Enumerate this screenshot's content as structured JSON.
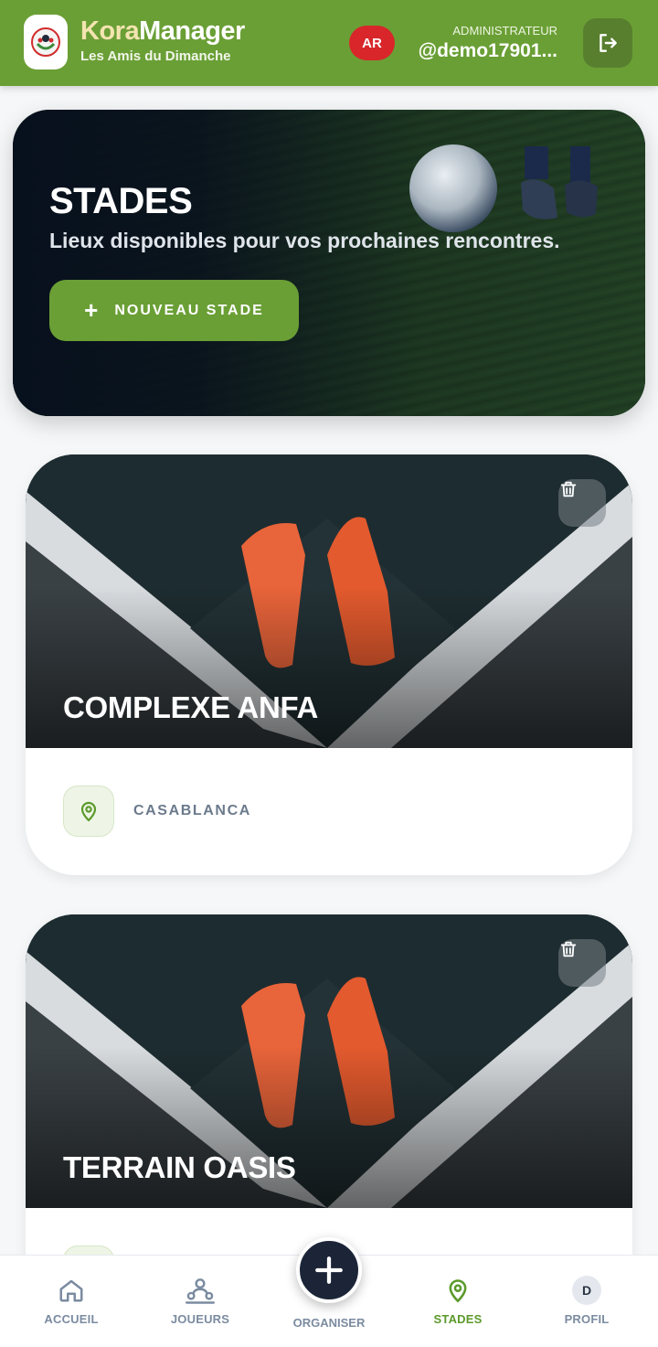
{
  "header": {
    "brand_prefix": "Kora",
    "brand_suffix": "Manager",
    "subtitle": "Les Amis du Dimanche",
    "language_button": "AR",
    "role_label": "ADMINISTRATEUR",
    "user_handle": "@demo17901..."
  },
  "hero": {
    "title": "STADES",
    "subtitle": "Lieux disponibles pour vos prochaines rencontres.",
    "new_button_plus": "+",
    "new_button_label": "NOUVEAU STADE"
  },
  "stadiums": [
    {
      "name": "COMPLEXE ANFA",
      "city": "CASABLANCA"
    },
    {
      "name": "TERRAIN OASIS",
      "city": ""
    }
  ],
  "bottom_nav": {
    "home": "ACCUEIL",
    "players": "JOUEURS",
    "organize": "ORGANISER",
    "stadiums": "STADES",
    "profile": "PROFIL",
    "profile_initial": "D",
    "active": "stadiums"
  },
  "colors": {
    "brand_green": "#6a9f35",
    "language_red": "#d8262a",
    "nav_dark": "#1b2537",
    "muted_text": "#7b8ba0"
  }
}
